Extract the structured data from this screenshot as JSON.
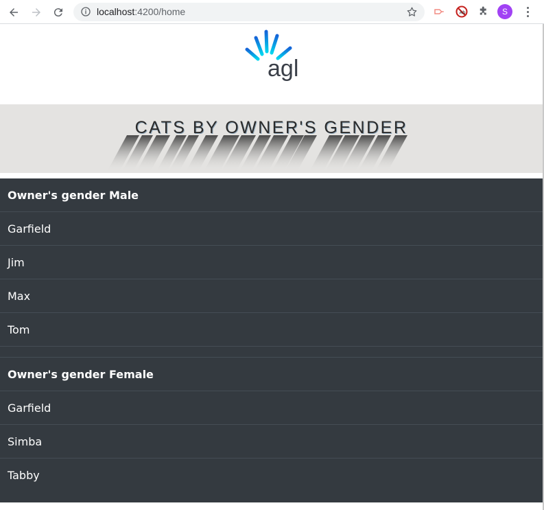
{
  "browser": {
    "url_host": "localhost",
    "url_path": ":4200/home",
    "profile_initial": "S",
    "icons": [
      "back-arrow-icon",
      "forward-arrow-icon",
      "reload-icon",
      "info-icon",
      "star-icon",
      "extension-icon",
      "adblock-icon",
      "puzzle-icon",
      "more-icon"
    ]
  },
  "logo": {
    "text": "agl",
    "colors": [
      "#00c8e8",
      "#0ea3e0",
      "#1570d6"
    ]
  },
  "banner": {
    "title": "CATS BY OWNER'S GENDER",
    "background": "#e4e3e1"
  },
  "groups": [
    {
      "header": "Owner's gender Male",
      "cats": [
        "Garfield",
        "Jim",
        "Max",
        "Tom"
      ]
    },
    {
      "header": "Owner's gender Female",
      "cats": [
        "Garfield",
        "Simba",
        "Tabby"
      ]
    }
  ],
  "colors": {
    "list_bg": "#343a40",
    "divider": "#454d55"
  }
}
